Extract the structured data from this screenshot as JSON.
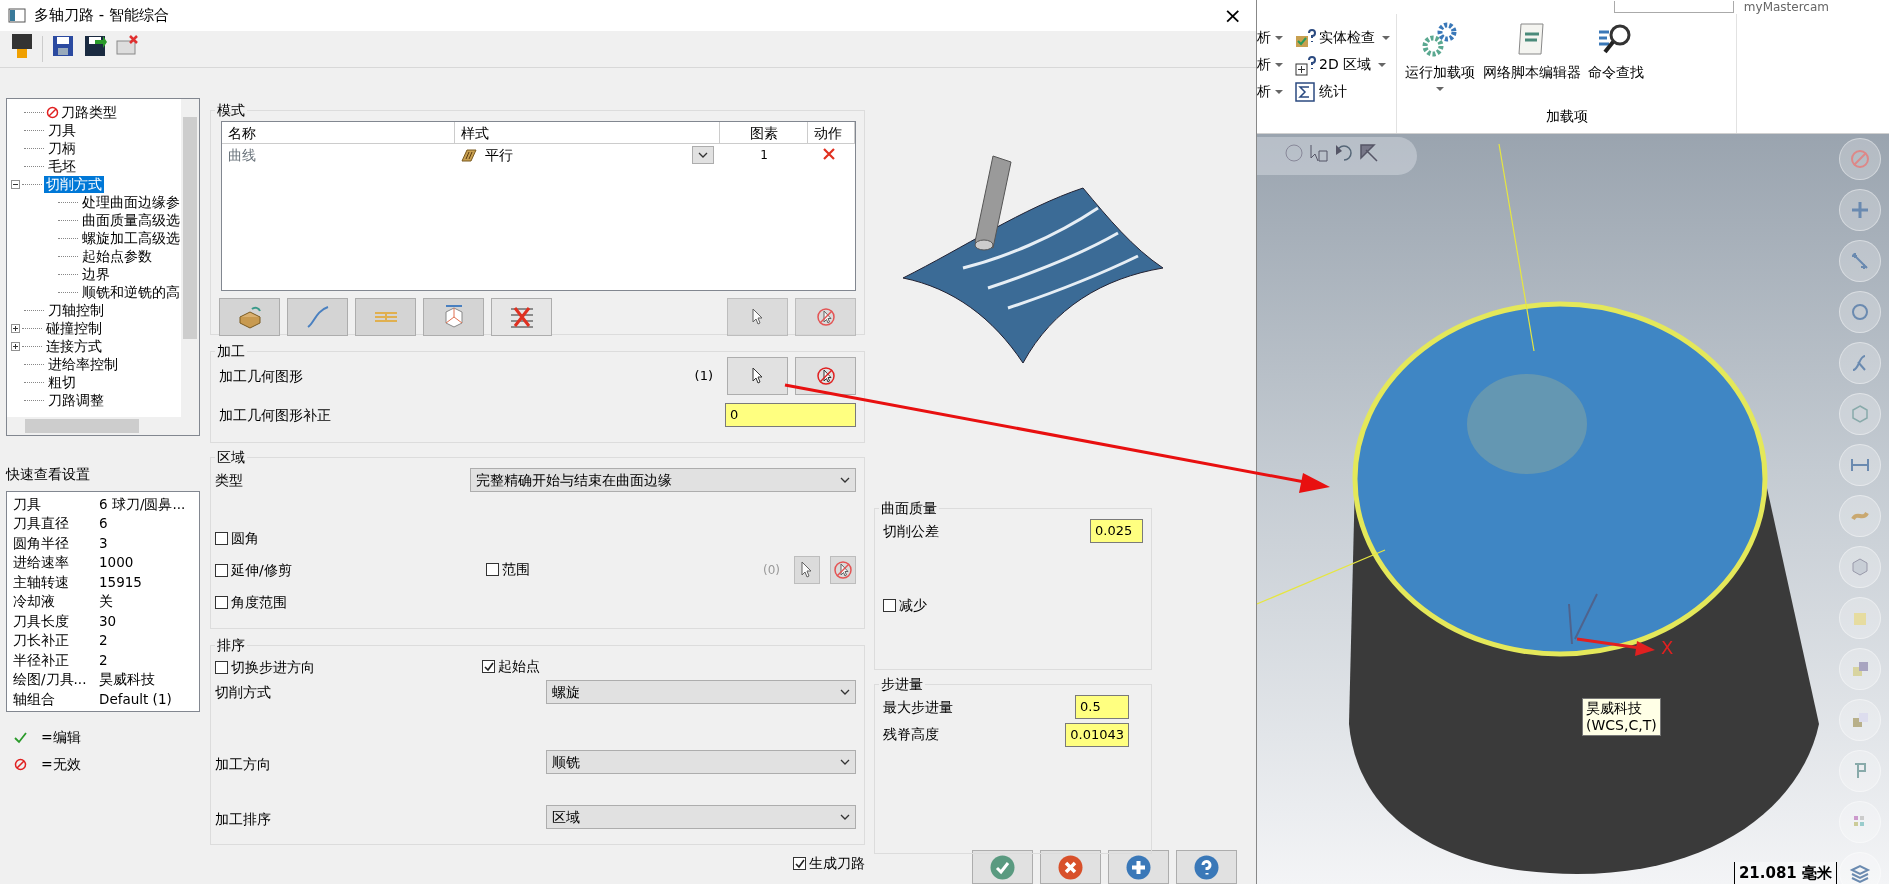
{
  "window": {
    "title": "多轴刀路 - 智能综合",
    "close": "×"
  },
  "tree": {
    "items": [
      {
        "label": "刀路类型",
        "invalid": true,
        "selected": false
      },
      {
        "label": "刀具",
        "invalid": false,
        "selected": false
      },
      {
        "label": "刀柄",
        "invalid": false,
        "selected": false
      },
      {
        "label": "毛坯",
        "invalid": false,
        "selected": false
      },
      {
        "label": "切削方式",
        "invalid": false,
        "selected": true,
        "expanded": true,
        "children": [
          {
            "label": "处理曲面边缘参",
            "selected": false
          },
          {
            "label": "曲面质量高级选",
            "selected": false
          },
          {
            "label": "螺旋加工高级选",
            "selected": false
          },
          {
            "label": "起始点参数",
            "selected": false
          },
          {
            "label": "边界",
            "selected": false
          },
          {
            "label": "顺铣和逆铣的高",
            "selected": false
          }
        ]
      },
      {
        "label": "刀轴控制",
        "invalid": false,
        "selected": false
      },
      {
        "label": "碰撞控制",
        "invalid": false,
        "selected": false,
        "expanded": false
      },
      {
        "label": "连接方式",
        "invalid": false,
        "selected": false,
        "expanded": false
      },
      {
        "label": "进给率控制",
        "invalid": false,
        "selected": false
      },
      {
        "label": "粗切",
        "invalid": false,
        "selected": false
      },
      {
        "label": "刀路调整",
        "invalid": false,
        "selected": false
      }
    ]
  },
  "quick_view": {
    "title": "快速查看设置",
    "rows": [
      [
        "刀具",
        "6 球刀/圆鼻..."
      ],
      [
        "刀具直径",
        "6"
      ],
      [
        "圆角半径",
        "3"
      ],
      [
        "进给速率",
        "1000"
      ],
      [
        "主轴转速",
        "15915"
      ],
      [
        "冷却液",
        "关"
      ],
      [
        "刀具长度",
        "30"
      ],
      [
        "刀长补正",
        "2"
      ],
      [
        "半径补正",
        "2"
      ],
      [
        "绘图/刀具...",
        "昊威科技"
      ],
      [
        "轴组合",
        "Default (1)"
      ]
    ]
  },
  "legend": [
    {
      "kind": "edited",
      "label": "=编辑"
    },
    {
      "kind": "invalid",
      "label": "=无效"
    }
  ],
  "mode": {
    "title": "模式",
    "columns": [
      "名称",
      "样式",
      "图素",
      "动作"
    ],
    "rows": [
      {
        "name": "曲线",
        "style": "平行",
        "count": "1"
      }
    ]
  },
  "machining": {
    "title": "加工",
    "geometry_label": "加工几何图形",
    "geometry_count": "(1)",
    "offset_label": "加工几何图形补正",
    "offset_value": "0"
  },
  "region": {
    "title": "区域",
    "type_label": "类型",
    "type_value": "完整精确开始与结束在曲面边缘",
    "options": [
      {
        "label": "圆角",
        "checked": false
      },
      {
        "label": "延伸/修剪",
        "checked": false
      },
      {
        "label": "角度范围",
        "checked": false
      }
    ],
    "range": {
      "label": "范围",
      "checked": false,
      "count": "(0)"
    }
  },
  "sorting": {
    "title": "排序",
    "toggle": {
      "label": "切换步进方向",
      "checked": false
    },
    "start_point": {
      "label": "起始点",
      "checked": true
    },
    "fields": [
      {
        "label": "切削方式",
        "value": "螺旋"
      },
      {
        "label": "加工方向",
        "value": "顺铣"
      },
      {
        "label": "加工排序",
        "value": "区域"
      }
    ]
  },
  "generate": {
    "label": "生成刀路",
    "checked": true
  },
  "surface_quality": {
    "title": "曲面质量",
    "tolerance_label": "切削公差",
    "tolerance_value": "0.025",
    "reduce": {
      "label": "减少",
      "checked": false
    }
  },
  "stepover": {
    "title": "步进量",
    "fields": [
      {
        "label": "最大步进量",
        "value": "0.5"
      },
      {
        "label": "残脊高度",
        "value": "0.01043"
      }
    ]
  },
  "dialog_buttons": [
    {
      "kind": "ok"
    },
    {
      "kind": "cancel"
    },
    {
      "kind": "add"
    },
    {
      "kind": "help"
    }
  ],
  "app": {
    "account": "myMastercam",
    "ribbon_left": [
      {
        "label": "析",
        "dropdown": true
      },
      {
        "label": "析",
        "dropdown": true
      },
      {
        "label": "析",
        "dropdown": true
      }
    ],
    "ribbon_tools": [
      {
        "kind": "check",
        "label": "实体检查",
        "dropdown": true
      },
      {
        "kind": "region",
        "label": "2D 区域",
        "dropdown": true
      },
      {
        "kind": "stats",
        "label": "统计",
        "dropdown": false
      }
    ],
    "addins": {
      "label": "加载项",
      "buttons": [
        {
          "kind": "run",
          "label": "运行加载项"
        },
        {
          "kind": "script",
          "label": "网络脚本编辑器"
        },
        {
          "kind": "find",
          "label": "命令查找"
        }
      ]
    },
    "viewport": {
      "wcs_label": "昊威科技",
      "wcs_sub": "(WCS,C,T)",
      "axis_x": "X",
      "scale": "21.081 毫米"
    }
  }
}
